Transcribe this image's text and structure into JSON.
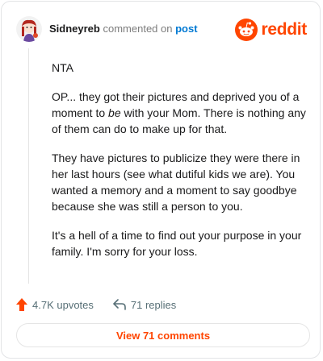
{
  "header": {
    "username": "Sidneyreb",
    "verb": "commented on",
    "post_link": "post",
    "brand_word": "reddit"
  },
  "comment": {
    "paragraphs": [
      {
        "text": "NTA"
      },
      {
        "before": "OP... they got their pictures and deprived you of a moment to ",
        "emph": "be",
        "after": " with your Mom. There is nothing any of them can do to make up for that."
      },
      {
        "text": "They have pictures to publicize they were there in her last hours (see what dutiful kids we are). You wanted a memory and a moment to say goodbye because she was still a person to you."
      },
      {
        "text": "It's a hell of a time to find out your purpose in your family. I'm sorry for your loss."
      }
    ]
  },
  "footer": {
    "upvotes": "4.7K upvotes",
    "replies": "71 replies",
    "view_button": "View 71 comments"
  },
  "colors": {
    "brand": "#ff4500",
    "link": "#0079d3",
    "muted": "#576f76"
  }
}
